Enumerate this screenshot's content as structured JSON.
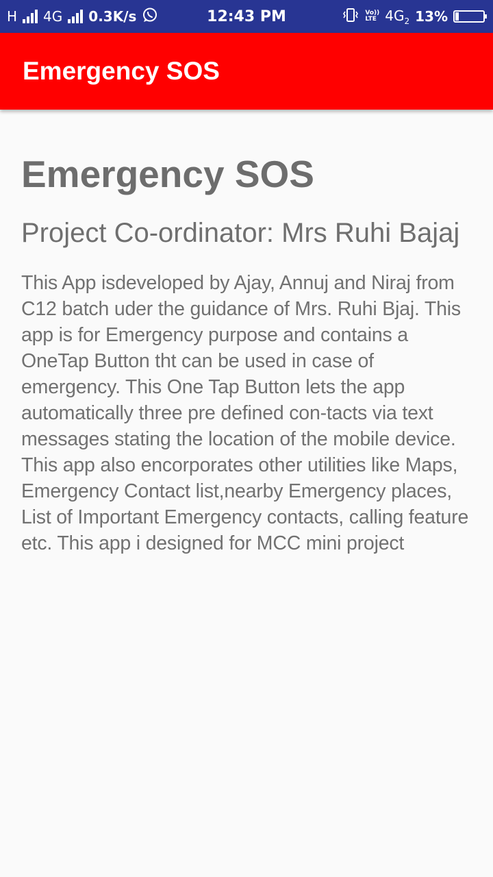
{
  "status_bar": {
    "network_1": "H",
    "network_2": "4G",
    "speed": "0.3K/s",
    "time": "12:43 PM",
    "volte_top": "Vo))",
    "volte_bottom": "LTE",
    "network_3": "4G",
    "sim_index": "2",
    "battery_percent": "13%",
    "battery_level": 0.13,
    "icons": [
      "signal-icon",
      "whatsapp-icon",
      "vibrate-icon",
      "battery-icon"
    ]
  },
  "app_bar": {
    "title": "Emergency SOS",
    "color": "#ff0000"
  },
  "content": {
    "heading": "Emergency SOS",
    "coordinator": "Project Co-ordinator: Mrs Ruhi Bajaj",
    "description": "This App isdeveloped by Ajay, Annuj and Niraj from C12 batch uder the guidance of Mrs. Ruhi Bjaj. This app is for Emergency purpose and contains a OneTap Button tht can be used in case of emergency. This One Tap Button lets the app automatically three pre defined con-tacts via text messages stating the location of the mobile device. This app also encorporates other utilities like Maps, Emergency Contact list,nearby Emergency places, List of Important Emergency contacts, calling feature etc. This app i designed for MCC mini project"
  }
}
